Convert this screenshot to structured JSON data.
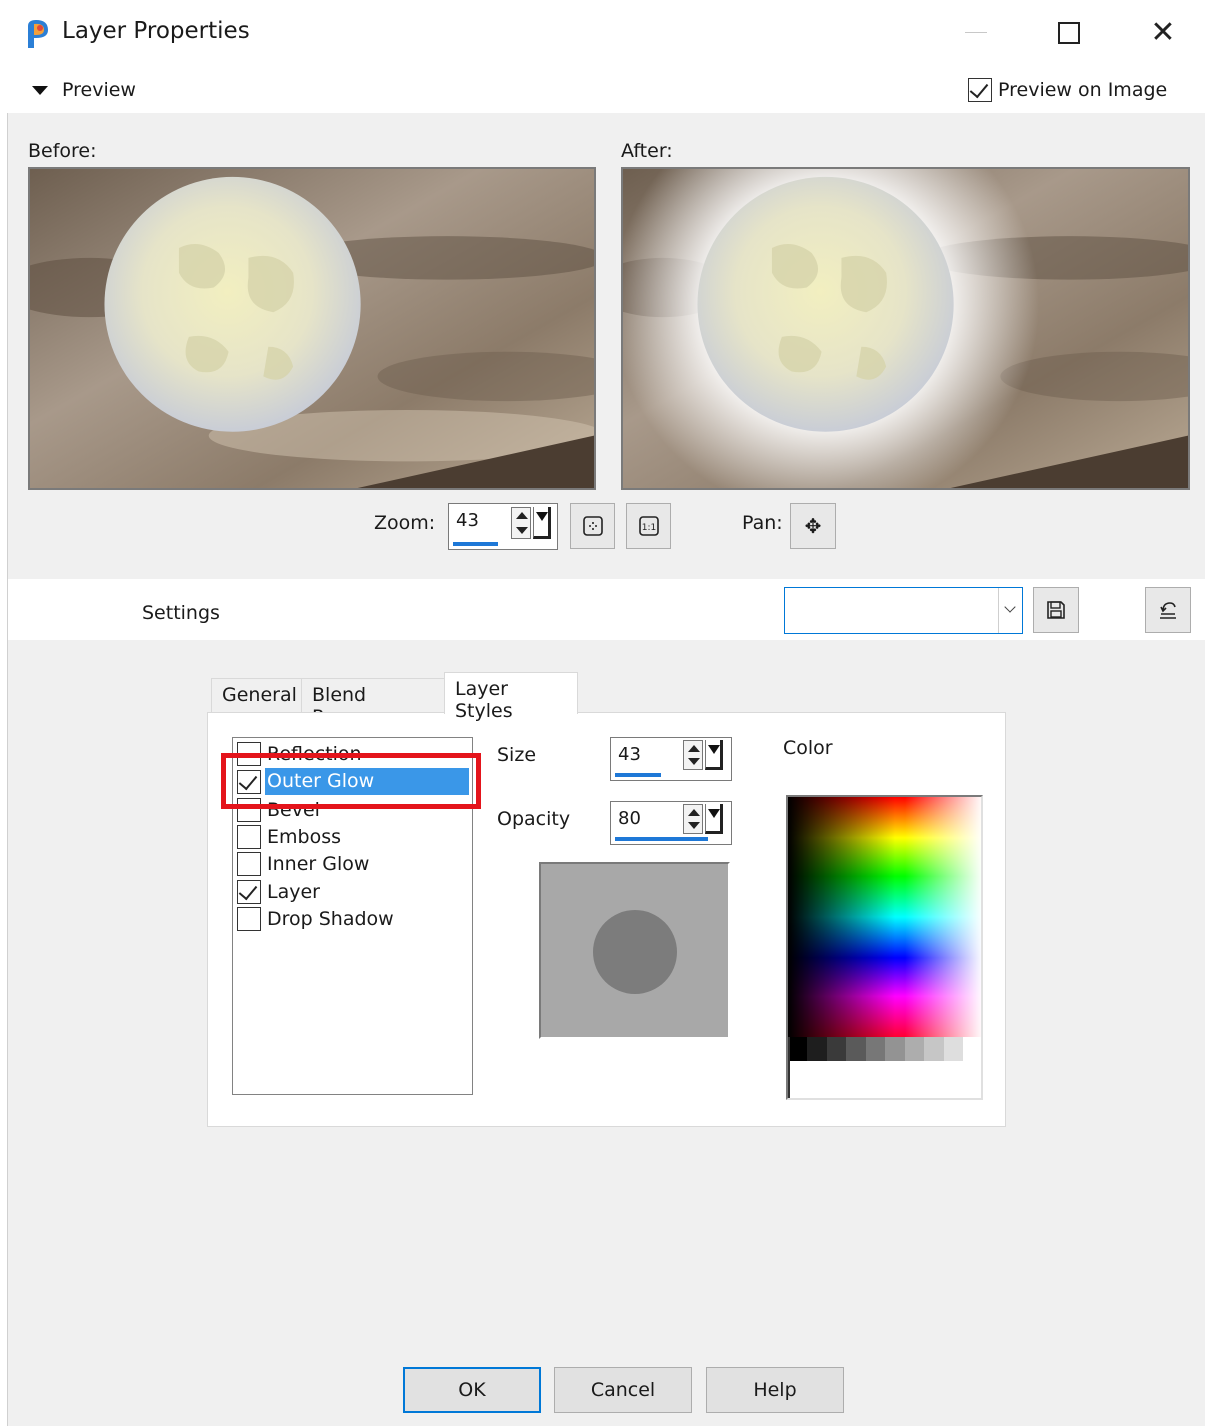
{
  "window": {
    "title": "Layer Properties",
    "icon": "paintshop-pro-icon"
  },
  "preview": {
    "toggle_label": "Preview",
    "preview_on_image_label": "Preview on Image",
    "preview_on_image_checked": true,
    "before_label": "Before:",
    "after_label": "After:",
    "zoom_label": "Zoom:",
    "zoom_value": "43",
    "zoom_level_fraction": 0.43,
    "pan_label": "Pan:"
  },
  "settings": {
    "label": "Settings",
    "preset_value": ""
  },
  "tabs": [
    {
      "label": "General",
      "active": false
    },
    {
      "label": "Blend Ranges",
      "active": false
    },
    {
      "label": "Layer Styles",
      "active": true
    }
  ],
  "layer_styles": {
    "items": [
      {
        "label": "Reflection",
        "checked": false,
        "selected": false
      },
      {
        "label": "Outer Glow",
        "checked": true,
        "selected": true
      },
      {
        "label": "Bevel",
        "checked": false,
        "selected": false
      },
      {
        "label": "Emboss",
        "checked": false,
        "selected": false
      },
      {
        "label": "Inner Glow",
        "checked": false,
        "selected": false
      },
      {
        "label": "Layer",
        "checked": true,
        "selected": false
      },
      {
        "label": "Drop Shadow",
        "checked": false,
        "selected": false
      }
    ],
    "size_label": "Size",
    "size_value": "43",
    "size_fraction": 0.43,
    "opacity_label": "Opacity",
    "opacity_value": "80",
    "opacity_fraction": 0.8,
    "color_label": "Color"
  },
  "colors": {
    "selection": "#3a97e8",
    "accent": "#0078d7",
    "highlight_annotation": "#e4141b"
  },
  "buttons": {
    "ok": "OK",
    "cancel": "Cancel",
    "help": "Help"
  }
}
